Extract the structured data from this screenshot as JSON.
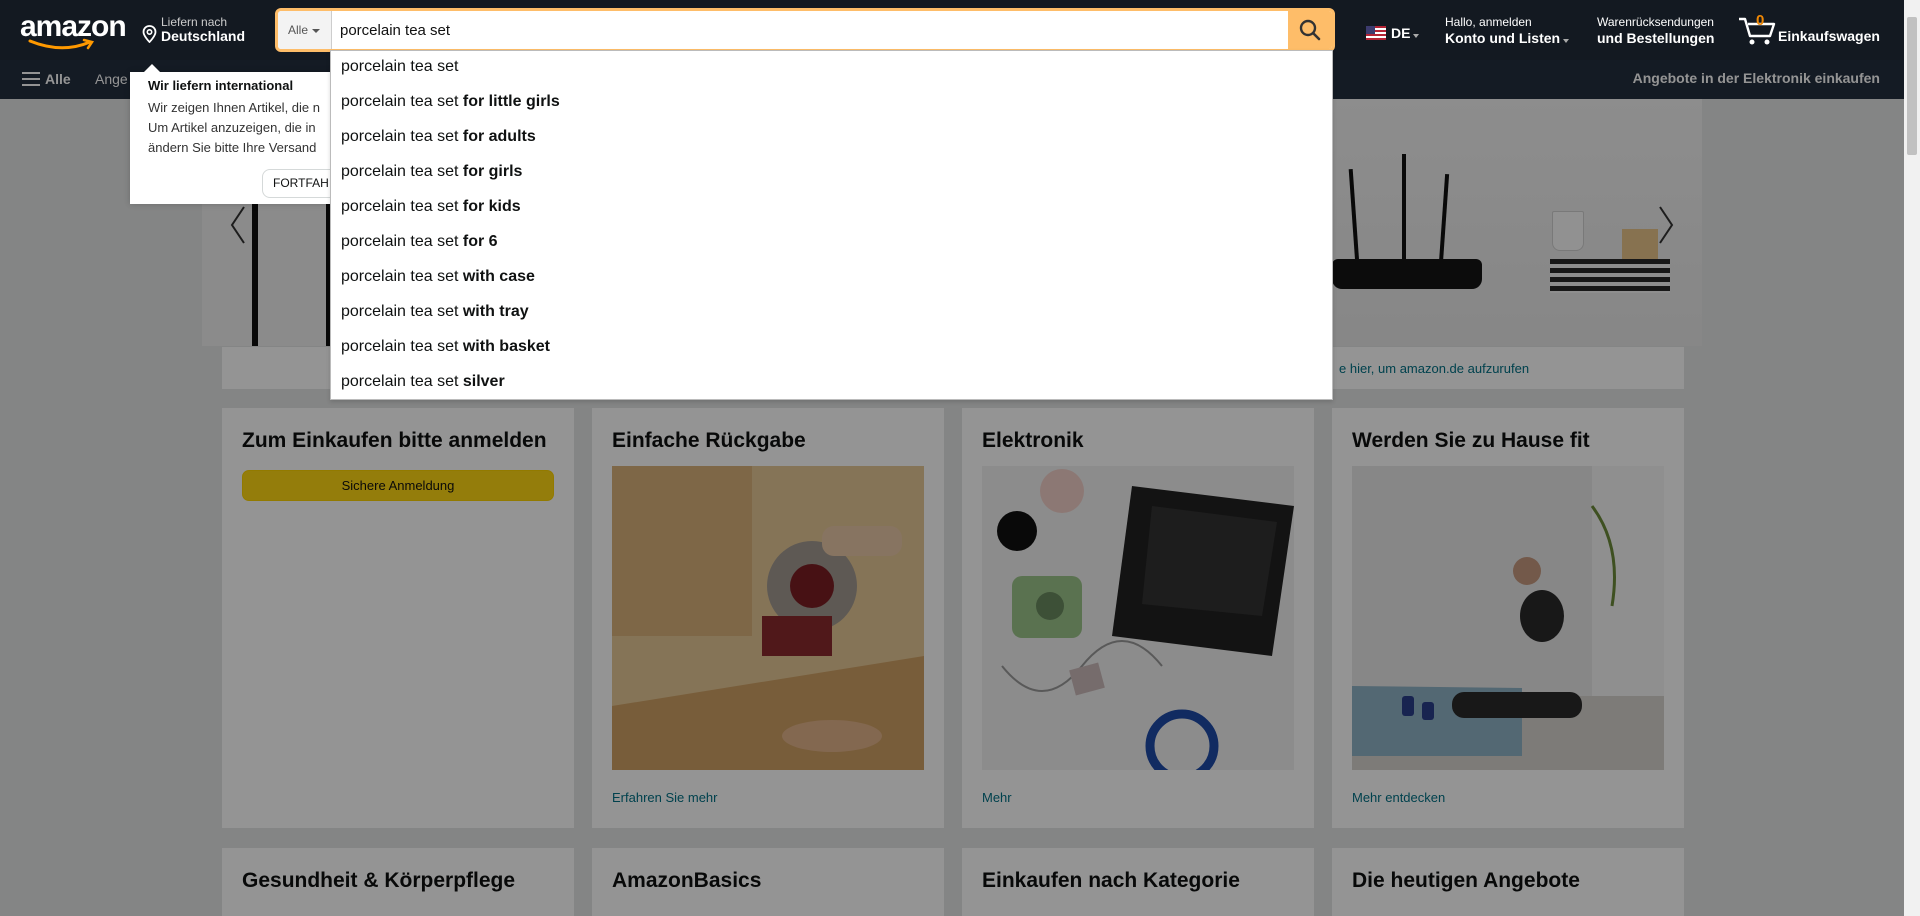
{
  "header": {
    "logo_text": "amazon",
    "deliver_line1": "Liefern nach",
    "deliver_line2": "Deutschland",
    "search_category": "Alle",
    "search_value": "porcelain tea set",
    "language": "DE",
    "account_line1": "Hallo, anmelden",
    "account_line2": "Konto und Listen",
    "returns_line1": "Warenrücksendungen",
    "returns_line2": "und Bestellungen",
    "cart_count": "0",
    "cart_label": "Einkaufswagen"
  },
  "subnav": {
    "all_label": "Alle",
    "partial_item": "Ange",
    "right_promo": "Angebote in der Elektronik einkaufen"
  },
  "popover": {
    "title": "Wir liefern international",
    "lines": [
      "Wir zeigen Ihnen Artikel, die n",
      "Um Artikel anzuzeigen, die in",
      "ändern Sie bitte Ihre Versand"
    ],
    "button": "FORTFAH"
  },
  "suggestions": [
    {
      "base": "porcelain tea set",
      "suffix": ""
    },
    {
      "base": "porcelain tea set",
      "suffix": "for little girls"
    },
    {
      "base": "porcelain tea set",
      "suffix": "for adults"
    },
    {
      "base": "porcelain tea set",
      "suffix": "for girls"
    },
    {
      "base": "porcelain tea set",
      "suffix": "for kids"
    },
    {
      "base": "porcelain tea set",
      "suffix": "for 6"
    },
    {
      "base": "porcelain tea set",
      "suffix": "with case"
    },
    {
      "base": "porcelain tea set",
      "suffix": "with tray"
    },
    {
      "base": "porcelain tea set",
      "suffix": "with basket"
    },
    {
      "base": "porcelain tea set",
      "suffix": "silver"
    }
  ],
  "strip_text": "e hier, um amazon.de aufzurufen",
  "cards": [
    {
      "title": "Zum Einkaufen bitte anmelden",
      "button": "Sichere Anmeldung"
    },
    {
      "title": "Einfache Rückgabe",
      "link": "Erfahren Sie mehr"
    },
    {
      "title": "Elektronik",
      "link": "Mehr"
    },
    {
      "title": "Werden Sie zu Hause fit",
      "link": "Mehr entdecken"
    }
  ],
  "cards_row2": [
    {
      "title": "Gesundheit & Körperpflege"
    },
    {
      "title": "AmazonBasics"
    },
    {
      "title": "Einkaufen nach Kategorie"
    },
    {
      "title": "Die heutigen Angebote"
    }
  ],
  "colors": {
    "nav_dark": "#131921",
    "nav_sub": "#232f3e",
    "search_button": "#febd69",
    "cart_count": "#f08804",
    "link": "#007185",
    "signin_button": "#ffd814"
  },
  "icons": [
    "location-pin-icon",
    "caret-down-icon",
    "search-icon",
    "us-flag-icon",
    "cart-icon",
    "hamburger-icon",
    "chevron-left-icon",
    "chevron-right-icon"
  ]
}
